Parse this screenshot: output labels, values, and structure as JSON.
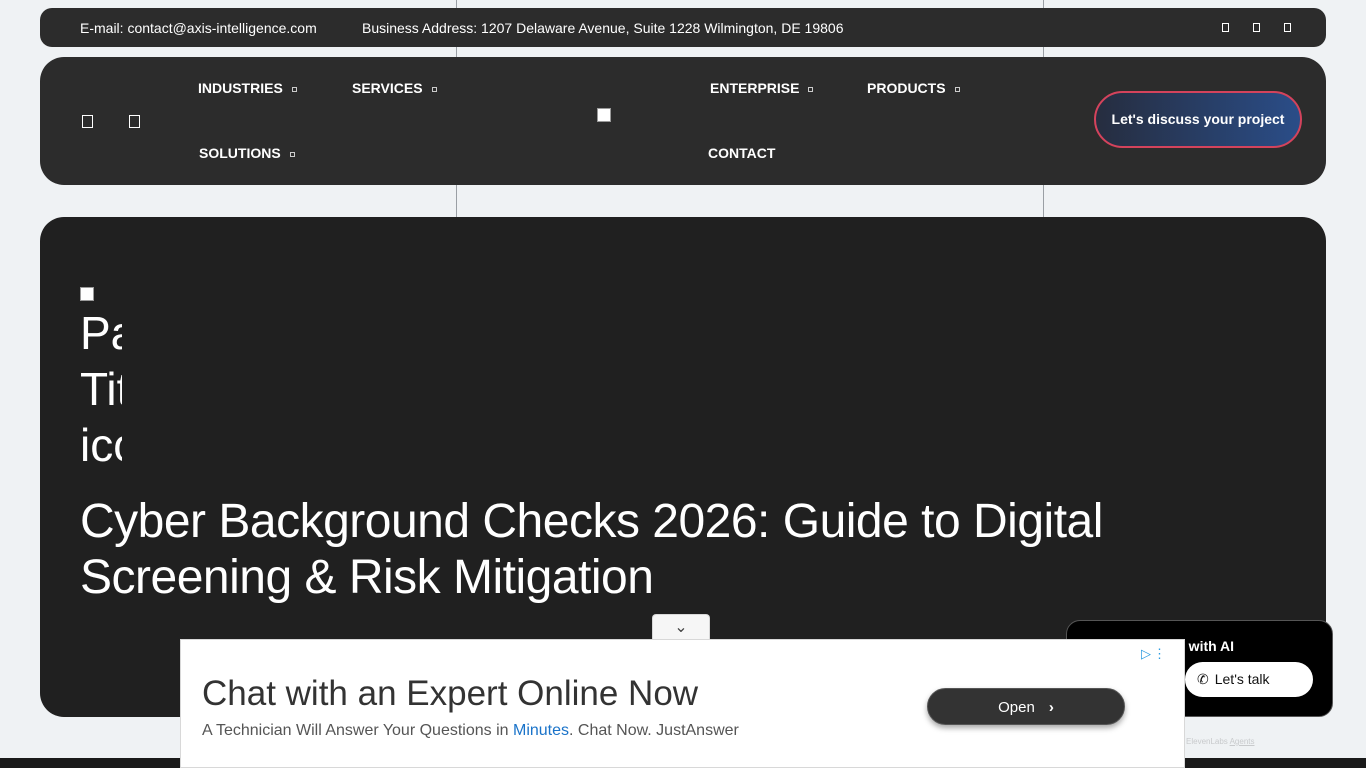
{
  "topbar": {
    "email": "E-mail: contact@axis-intelligence.com",
    "address": "Business Address: 1207 Delaware Avenue, Suite 1228 Wilmington, DE 19806",
    "social_icons": [
      "social-icon-1",
      "social-icon-2",
      "social-icon-3"
    ]
  },
  "nav": {
    "left_icons": [
      "menu-icon",
      "search-icon"
    ],
    "items": [
      {
        "label": "INDUSTRIES",
        "has_dropdown": true
      },
      {
        "label": "SERVICES",
        "has_dropdown": true
      },
      {
        "label": "SOLUTIONS",
        "has_dropdown": true
      },
      {
        "label": "ENTERPRISE",
        "has_dropdown": true
      },
      {
        "label": "PRODUCTS",
        "has_dropdown": true
      },
      {
        "label": "CONTACT",
        "has_dropdown": false
      }
    ],
    "cta_label": "Let's discuss your project"
  },
  "hero": {
    "broken_image_alt": "Page Title icon",
    "title": "Cyber Background Checks 2026: Guide to Digital Screening & Risk Mitigation"
  },
  "ad": {
    "toggle_icon": "chevron-down-icon",
    "headline": "Chat with an Expert Online Now",
    "desc_before": "A Technician Will Answer Your Questions in ",
    "desc_highlight": "Minutes",
    "desc_after": ". Chat Now. JustAnswer",
    "button_label": "Open"
  },
  "chat_widget": {
    "title_visible": "k with AI",
    "button_label": "Let's talk",
    "credit_prefix": "ElevenLabs",
    "credit_link": "Agents"
  },
  "colors": {
    "page_bg": "#eff2f4",
    "panel_bg": "#2c2c2c",
    "hero_bg": "#202020",
    "cta_border": "#d4435c",
    "cta_gradient_end": "#2a4d88",
    "ad_link": "#1a73c9"
  }
}
